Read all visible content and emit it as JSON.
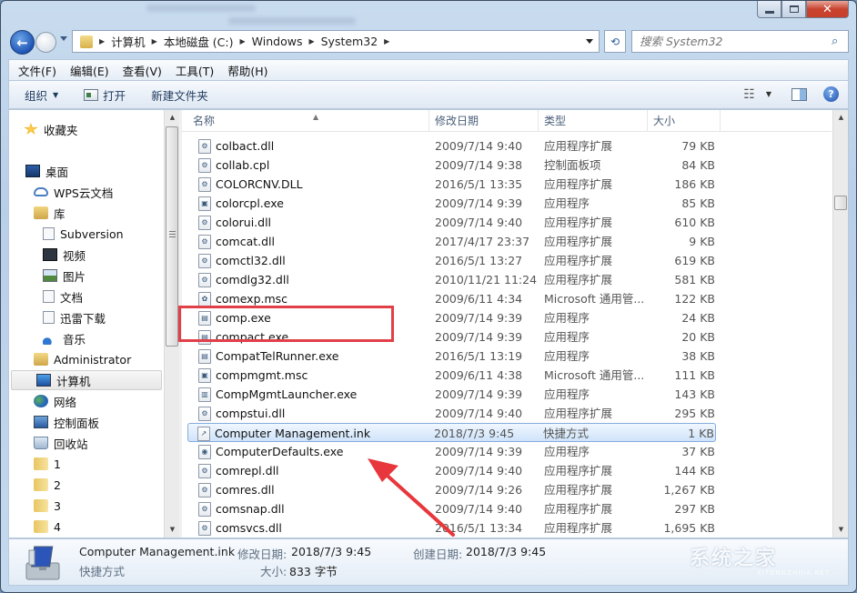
{
  "window": {
    "caption_buttons": {
      "minimize": "minimize",
      "maximize": "maximize",
      "close": "✕"
    }
  },
  "nav": {
    "back_icon": "←",
    "breadcrumb": [
      "计算机",
      "本地磁盘 (C:)",
      "Windows",
      "System32"
    ],
    "refresh_icon": "⟲",
    "search_placeholder": "搜索 System32",
    "search_icon": "⌕"
  },
  "menubar": [
    "文件(F)",
    "编辑(E)",
    "查看(V)",
    "工具(T)",
    "帮助(H)"
  ],
  "toolbar": {
    "organize": "组织",
    "open": "打开",
    "new_folder": "新建文件夹",
    "help_icon": "?"
  },
  "sidebar": {
    "items": [
      {
        "label": "收藏夹",
        "icon": "star-icon",
        "indent": 0
      },
      {
        "label": "桌面",
        "icon": "desktop-icon",
        "indent": 0
      },
      {
        "label": "WPS云文档",
        "icon": "cloud-icon",
        "indent": 1
      },
      {
        "label": "库",
        "icon": "library-icon",
        "indent": 1
      },
      {
        "label": "Subversion",
        "icon": "document-icon",
        "indent": 2
      },
      {
        "label": "视频",
        "icon": "video-icon",
        "indent": 2
      },
      {
        "label": "图片",
        "icon": "picture-icon",
        "indent": 2
      },
      {
        "label": "文档",
        "icon": "document-icon",
        "indent": 2
      },
      {
        "label": "迅雷下载",
        "icon": "document-icon",
        "indent": 2
      },
      {
        "label": "音乐",
        "icon": "music-icon",
        "indent": 2
      },
      {
        "label": "Administrator",
        "icon": "user-folder-icon",
        "indent": 1
      },
      {
        "label": "计算机",
        "icon": "computer-icon",
        "indent": 1,
        "selected": true
      },
      {
        "label": "网络",
        "icon": "network-icon",
        "indent": 1
      },
      {
        "label": "控制面板",
        "icon": "control-panel-icon",
        "indent": 1
      },
      {
        "label": "回收站",
        "icon": "recycle-bin-icon",
        "indent": 1
      },
      {
        "label": "1",
        "icon": "folder-icon",
        "indent": 1
      },
      {
        "label": "2",
        "icon": "folder-icon",
        "indent": 1
      },
      {
        "label": "3",
        "icon": "folder-icon",
        "indent": 1
      },
      {
        "label": "4",
        "icon": "folder-icon",
        "indent": 1
      }
    ]
  },
  "filelist": {
    "columns": [
      "名称",
      "修改日期",
      "类型",
      "大小"
    ],
    "rows": [
      {
        "name": "colbact.dll",
        "date": "2009/7/14 9:40",
        "type": "应用程序扩展",
        "size": "79 KB",
        "icon": "dll-icon"
      },
      {
        "name": "collab.cpl",
        "date": "2009/7/14 9:38",
        "type": "控制面板项",
        "size": "84 KB",
        "icon": "dll-icon"
      },
      {
        "name": "COLORCNV.DLL",
        "date": "2016/5/1 13:35",
        "type": "应用程序扩展",
        "size": "186 KB",
        "icon": "dll-icon"
      },
      {
        "name": "colorcpl.exe",
        "date": "2009/7/14 9:39",
        "type": "应用程序",
        "size": "85 KB",
        "icon": "color-monitor-icon"
      },
      {
        "name": "colorui.dll",
        "date": "2009/7/14 9:40",
        "type": "应用程序扩展",
        "size": "610 KB",
        "icon": "dll-icon"
      },
      {
        "name": "comcat.dll",
        "date": "2017/4/17 23:37",
        "type": "应用程序扩展",
        "size": "9 KB",
        "icon": "dll-icon"
      },
      {
        "name": "comctl32.dll",
        "date": "2016/5/1 13:27",
        "type": "应用程序扩展",
        "size": "619 KB",
        "icon": "dll-icon"
      },
      {
        "name": "comdlg32.dll",
        "date": "2010/11/21 11:24",
        "type": "应用程序扩展",
        "size": "581 KB",
        "icon": "dll-icon"
      },
      {
        "name": "comexp.msc",
        "date": "2009/6/11 4:34",
        "type": "Microsoft 通用管...",
        "size": "122 KB",
        "icon": "msc-icon"
      },
      {
        "name": "comp.exe",
        "date": "2009/7/14 9:39",
        "type": "应用程序",
        "size": "24 KB",
        "icon": "exe-icon"
      },
      {
        "name": "compact.exe",
        "date": "2009/7/14 9:39",
        "type": "应用程序",
        "size": "20 KB",
        "icon": "exe-icon"
      },
      {
        "name": "CompatTelRunner.exe",
        "date": "2016/5/1 13:19",
        "type": "应用程序",
        "size": "38 KB",
        "icon": "exe-icon"
      },
      {
        "name": "compmgmt.msc",
        "date": "2009/6/11 4:38",
        "type": "Microsoft 通用管...",
        "size": "111 KB",
        "icon": "computer-management-icon"
      },
      {
        "name": "CompMgmtLauncher.exe",
        "date": "2009/7/14 9:39",
        "type": "应用程序",
        "size": "143 KB",
        "icon": "launcher-icon"
      },
      {
        "name": "compstui.dll",
        "date": "2009/7/14 9:40",
        "type": "应用程序扩展",
        "size": "295 KB",
        "icon": "dll-icon"
      },
      {
        "name": "Computer Management.ink",
        "date": "2018/7/3 9:45",
        "type": "快捷方式",
        "size": "1 KB",
        "icon": "shortcut-icon",
        "selected": true
      },
      {
        "name": "ComputerDefaults.exe",
        "date": "2009/7/14 9:39",
        "type": "应用程序",
        "size": "37 KB",
        "icon": "defaults-icon"
      },
      {
        "name": "comrepl.dll",
        "date": "2009/7/14 9:40",
        "type": "应用程序扩展",
        "size": "144 KB",
        "icon": "dll-icon"
      },
      {
        "name": "comres.dll",
        "date": "2009/7/14 9:26",
        "type": "应用程序扩展",
        "size": "1,267 KB",
        "icon": "dll-icon"
      },
      {
        "name": "comsnap.dll",
        "date": "2009/7/14 9:40",
        "type": "应用程序扩展",
        "size": "297 KB",
        "icon": "dll-icon"
      },
      {
        "name": "comsvcs.dll",
        "date": "2016/5/1 13:34",
        "type": "应用程序扩展",
        "size": "1,695 KB",
        "icon": "dll-icon"
      }
    ]
  },
  "details": {
    "name": "Computer Management.ink",
    "type": "快捷方式",
    "modified_label": "修改日期:",
    "modified": "2018/7/3 9:45",
    "created_label": "创建日期:",
    "created": "2018/7/3 9:45",
    "size_label": "大小:",
    "size": "833 字节"
  },
  "annotation": {
    "highlight_color": "#e14049",
    "arrow_color": "#e8373c"
  },
  "watermark": {
    "text": "系统之家",
    "sub": "XITONGZHIJIA.NET"
  }
}
